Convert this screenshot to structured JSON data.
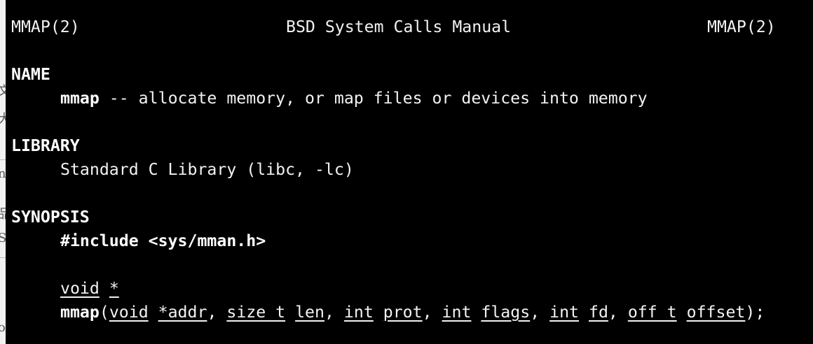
{
  "header": {
    "left": "MMAP(2)",
    "center": "BSD System Calls Manual",
    "right": "MMAP(2)"
  },
  "name": {
    "heading": "NAME",
    "command": "mmap",
    "description": " -- allocate memory, or map files or devices into memory"
  },
  "library": {
    "heading": "LIBRARY",
    "text": "Standard C Library (libc, -lc)"
  },
  "synopsis": {
    "heading": "SYNOPSIS",
    "include": "#include <sys/mman.h>",
    "return_type": "void",
    "pointer": "*",
    "func": "mmap",
    "open_paren": "(",
    "args": [
      {
        "type": "void",
        "name": "*addr"
      },
      {
        "type": "size_t",
        "name": "len"
      },
      {
        "type": "int",
        "name": "prot"
      },
      {
        "type": "int",
        "name": "flags"
      },
      {
        "type": "int",
        "name": "fd"
      },
      {
        "type": "off_t",
        "name": "offset"
      }
    ],
    "close": ");"
  }
}
